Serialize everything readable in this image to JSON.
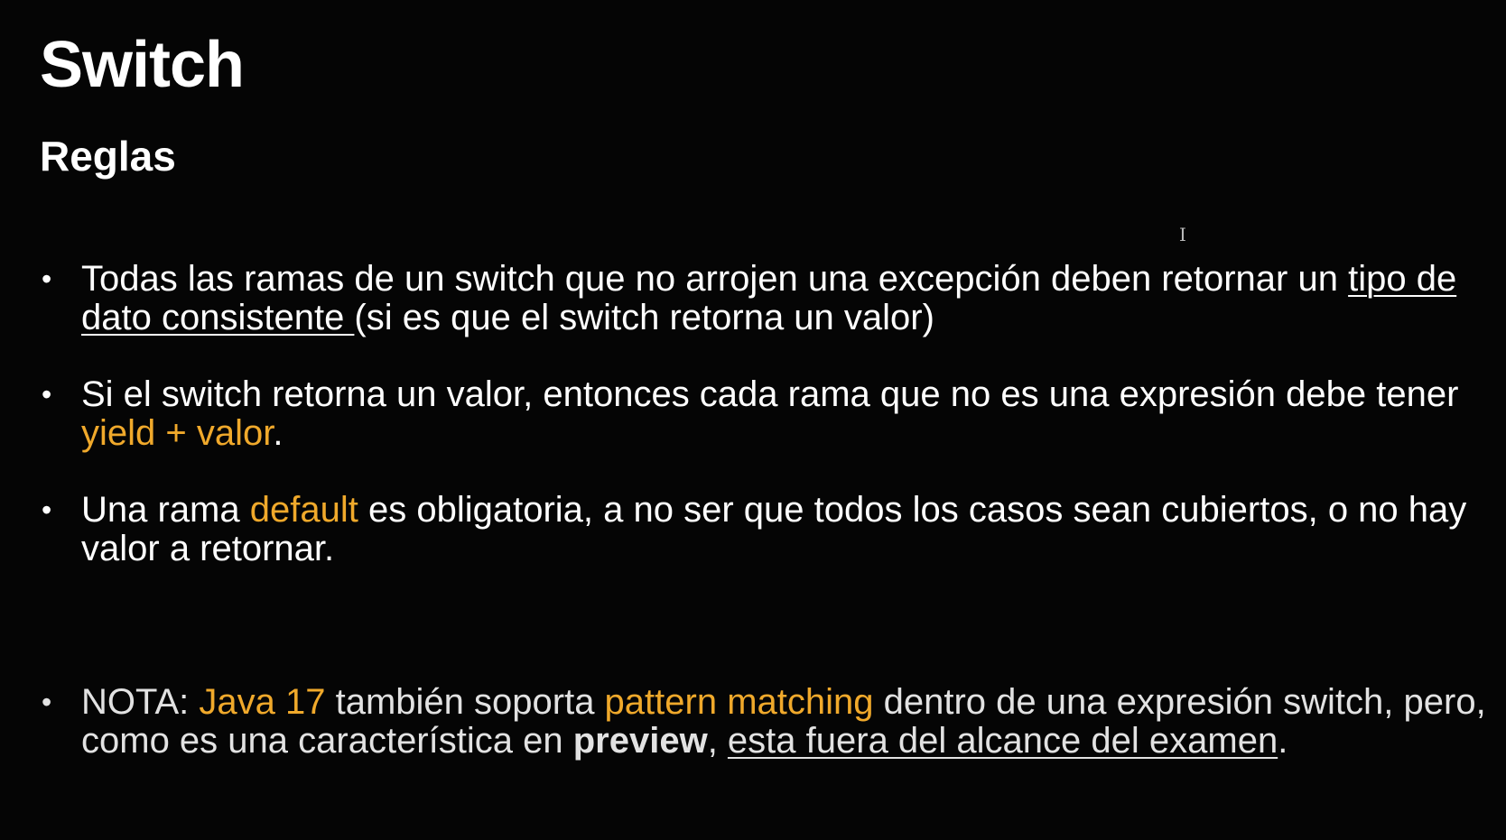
{
  "slide": {
    "title": "Switch",
    "subtitle": "Reglas",
    "bullet_glyph": "•",
    "bullets": [
      {
        "p1": "Todas las ramas de un switch que no arrojen una excepción deben retornar un ",
        "underlined": "tipo de dato consistente ",
        "p2": "(si es que el switch retorna un valor)"
      },
      {
        "p1": "Si el switch retorna un valor, entonces cada rama que no es una expresión debe tener ",
        "highlight": "yield + valor",
        "p2": "."
      },
      {
        "p1": "Una rama ",
        "highlight": "default",
        "p2": " es obligatoria, a no ser que todos los casos sean cubiertos, o no hay valor a retornar."
      },
      {
        "p1": "NOTA: ",
        "highlight1": "Java 17",
        "p2": " también soporta ",
        "highlight2": "pattern matching",
        "p3": " dentro de una expresión switch, pero, como es una característica en ",
        "bold": "preview",
        "p4": ", ",
        "underlined": "esta fuera del alcance del examen",
        "p5": "."
      }
    ],
    "cursor_glyph": "I"
  },
  "colors": {
    "background": "#050505",
    "text": "#ffffff",
    "highlight": "#f0a92b"
  }
}
